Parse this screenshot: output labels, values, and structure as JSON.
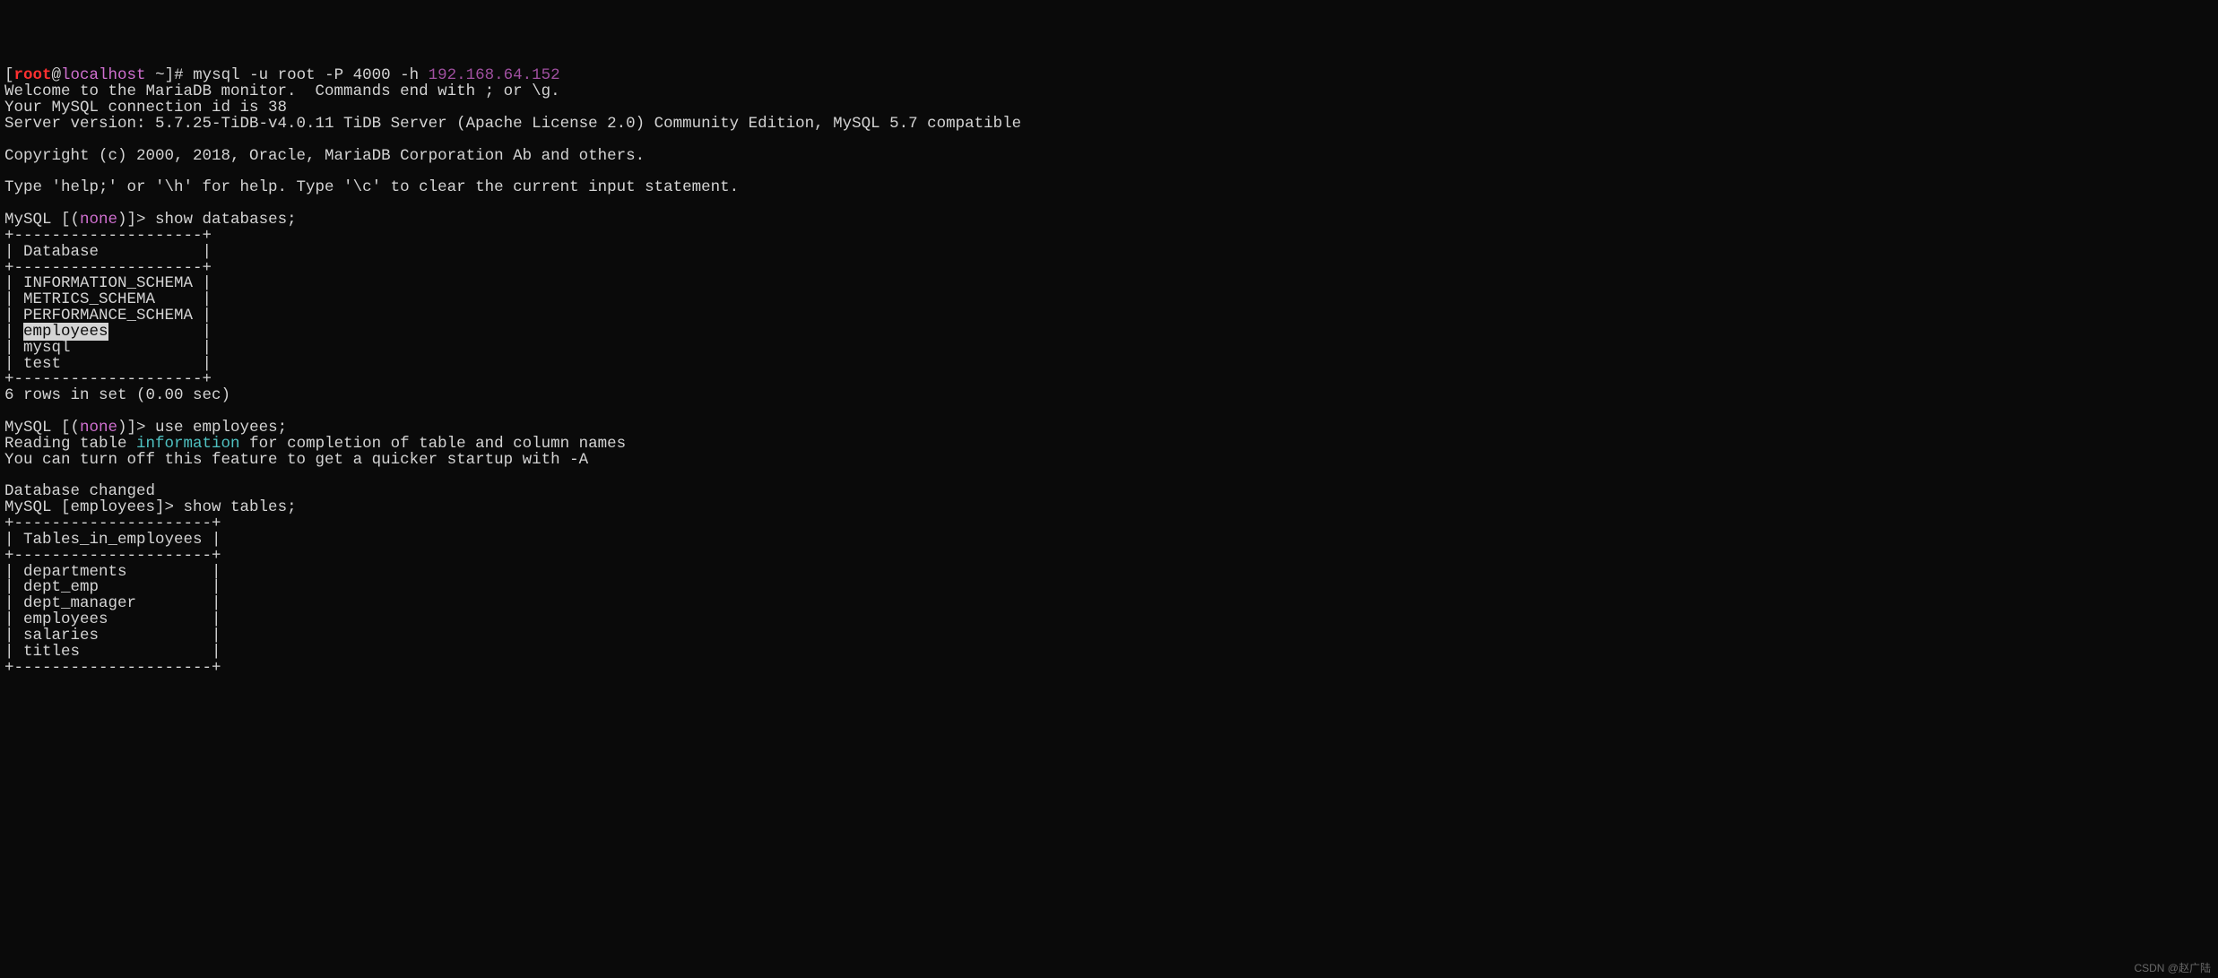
{
  "prompt1": {
    "open": "[",
    "user": "root",
    "at": "@",
    "host": "localhost",
    "cwd": " ~",
    "close": "]# ",
    "command_prefix": "mysql -u root -P 4000 -h ",
    "ip": "192.168.64.152"
  },
  "welcome": "Welcome to the MariaDB monitor.  Commands end with ; or \\g.",
  "conn_id": "Your MySQL connection id is 38",
  "server_version": "Server version: 5.7.25-TiDB-v4.0.11 TiDB Server (Apache License 2.0) Community Edition, MySQL 5.7 compatible",
  "copyright": "Copyright (c) 2000, 2018, Oracle, MariaDB Corporation Ab and others.",
  "help_line": "Type 'help;' or '\\h' for help. Type '\\c' to clear the current input statement.",
  "mysql_prompt_none": {
    "pre": "MySQL [(",
    "db": "none",
    "post": ")]> "
  },
  "cmd_show_db": "show databases;",
  "db_table": {
    "border": "+--------------------+",
    "header": "| Database           |",
    "rows": {
      "r0": "| INFORMATION_SCHEMA |",
      "r1": "| METRICS_SCHEMA     |",
      "r2": "| PERFORMANCE_SCHEMA |",
      "r3_pre": "| ",
      "r3_hl": "employees",
      "r3_post": "          |",
      "r4": "| mysql              |",
      "r5": "| test               |"
    },
    "rowcount": "6 rows in set (0.00 sec)"
  },
  "cmd_use": "use employees;",
  "reading": {
    "pre": "Reading table ",
    "info": "information",
    "post": " for completion of table and column names"
  },
  "turnoff": "You can turn off this feature to get a quicker startup with -A",
  "db_changed": "Database changed",
  "mysql_prompt_emp": "MySQL [employees]> ",
  "cmd_show_tables": "show tables;",
  "tables_table": {
    "border": "+---------------------+",
    "header": "| Tables_in_employees |",
    "rows": {
      "r0": "| departments         |",
      "r1": "| dept_emp            |",
      "r2": "| dept_manager        |",
      "r3": "| employees           |",
      "r4": "| salaries            |",
      "r5": "| titles              |"
    }
  },
  "watermark": "CSDN @赵广陆"
}
